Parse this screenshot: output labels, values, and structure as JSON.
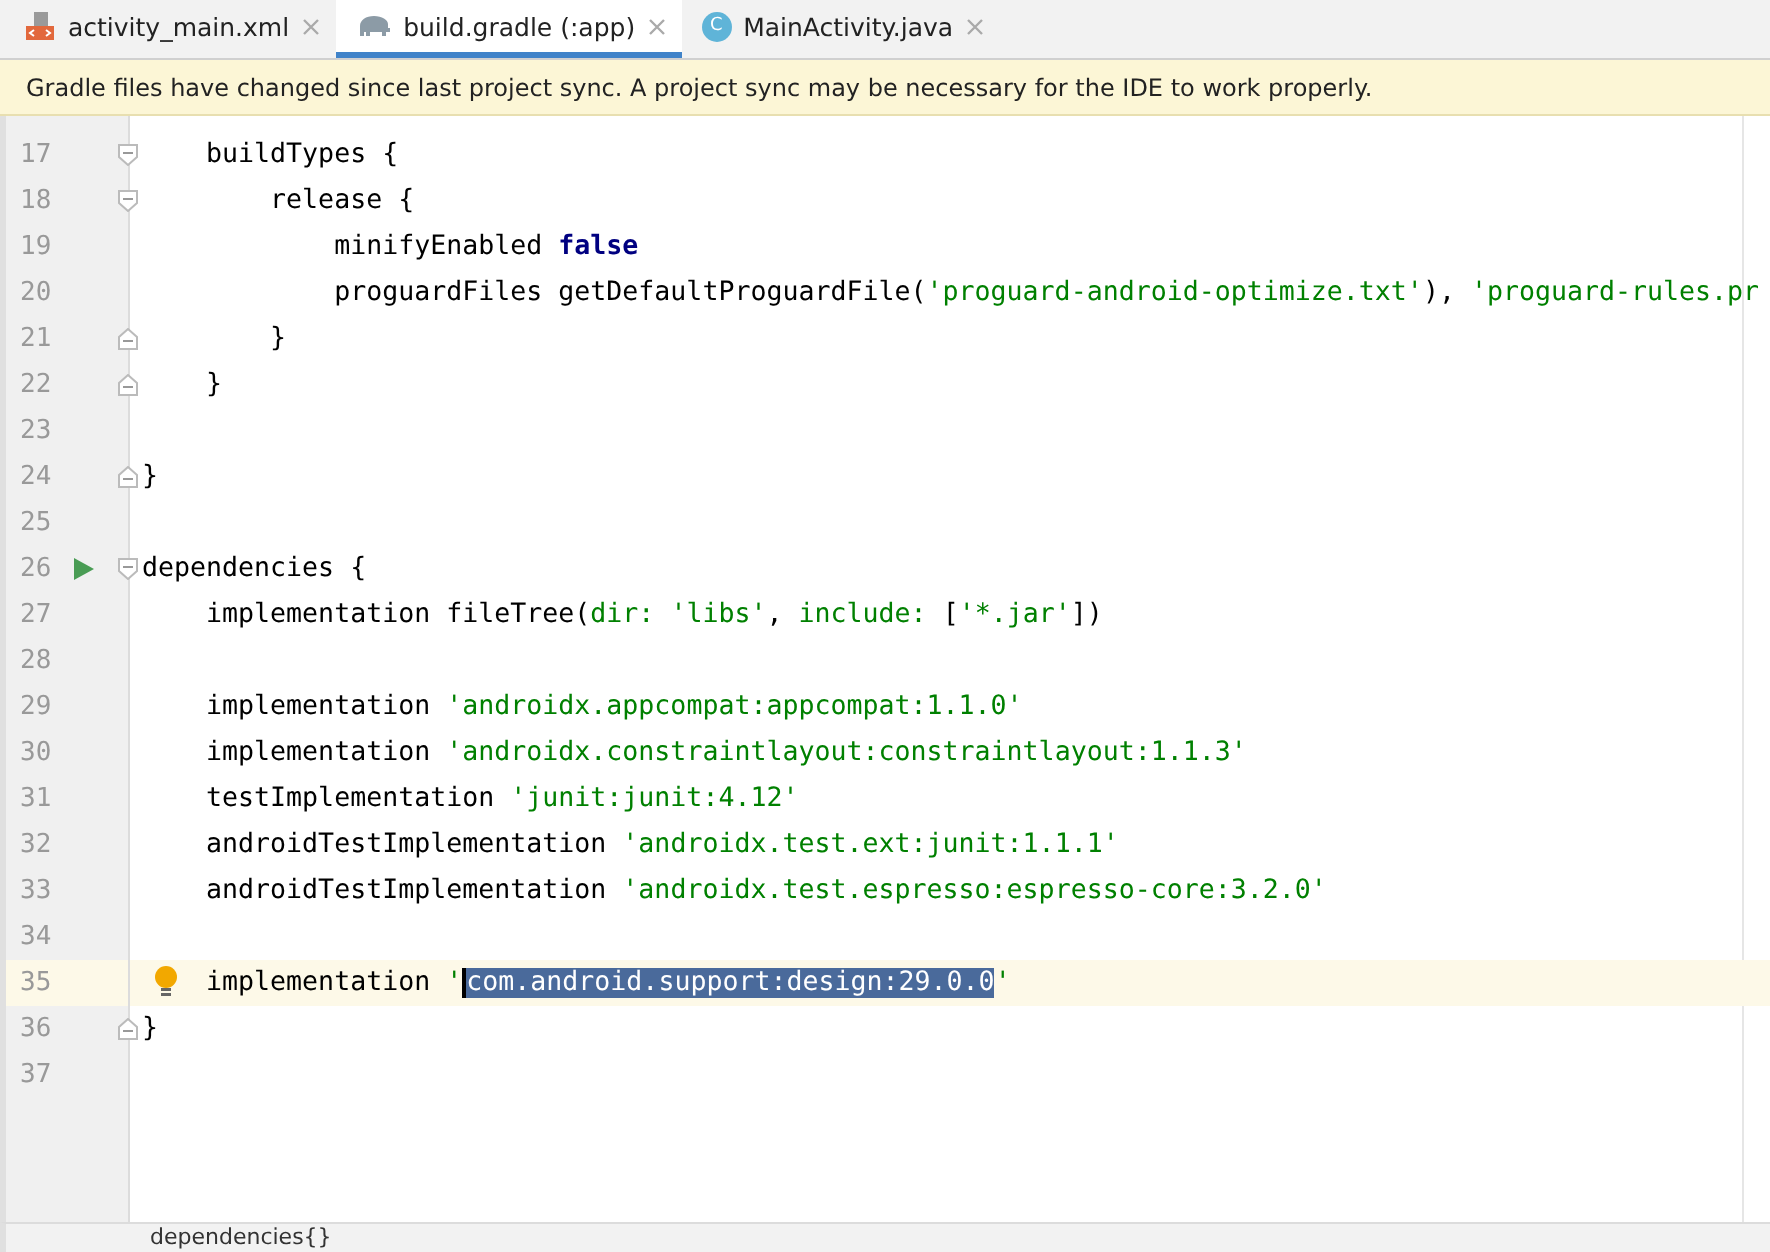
{
  "tabs": [
    {
      "label": "activity_main.xml",
      "kind": "xml",
      "selected": false
    },
    {
      "label": "build.gradle (:app)",
      "kind": "gradle",
      "selected": true
    },
    {
      "label": "MainActivity.java",
      "kind": "class",
      "icon_letter": "C",
      "selected": false
    }
  ],
  "banner": {
    "message": "Gradle files have changed since last project sync. A project sync may be necessary for the IDE to work properly."
  },
  "editor": {
    "lines": [
      {
        "number": "17",
        "kind": "block-start",
        "current": false,
        "tokens": [
          {
            "kind": "plain",
            "text": "    buildTypes {"
          }
        ]
      },
      {
        "number": "18",
        "kind": "block-start",
        "current": false,
        "tokens": [
          {
            "kind": "plain",
            "text": "        release {"
          }
        ]
      },
      {
        "number": "19",
        "kind": "plain",
        "current": false,
        "tokens": [
          {
            "kind": "plain",
            "text": "            minifyEnabled "
          },
          {
            "kind": "keyword",
            "text": "false"
          }
        ]
      },
      {
        "number": "20",
        "kind": "plain",
        "current": false,
        "tokens": [
          {
            "kind": "plain",
            "text": "            proguardFiles getDefaultProguardFile("
          },
          {
            "kind": "string",
            "text": "'proguard-android-optimize.txt'"
          },
          {
            "kind": "plain",
            "text": "), "
          },
          {
            "kind": "string",
            "text": "'proguard-rules.pr"
          }
        ]
      },
      {
        "number": "21",
        "kind": "block-end",
        "current": false,
        "tokens": [
          {
            "kind": "plain",
            "text": "        }"
          }
        ]
      },
      {
        "number": "22",
        "kind": "block-end",
        "current": false,
        "tokens": [
          {
            "kind": "plain",
            "text": "    }"
          }
        ]
      },
      {
        "number": "23",
        "kind": "plain",
        "current": false
      },
      {
        "number": "24",
        "kind": "block-end",
        "current": false,
        "tokens": [
          {
            "kind": "plain",
            "text": "}"
          }
        ]
      },
      {
        "number": "25",
        "kind": "plain",
        "current": false
      },
      {
        "number": "26",
        "kind": "run-block-start",
        "current": false,
        "tokens": [
          {
            "kind": "plain",
            "text": "dependencies {"
          }
        ]
      },
      {
        "number": "27",
        "kind": "plain",
        "current": false,
        "tokens": [
          {
            "kind": "plain",
            "text": "    implementation fileTree("
          },
          {
            "kind": "named",
            "text": "dir: "
          },
          {
            "kind": "string",
            "text": "'libs'"
          },
          {
            "kind": "plain",
            "text": ", "
          },
          {
            "kind": "named",
            "text": "include: "
          },
          {
            "kind": "plain",
            "text": "["
          },
          {
            "kind": "string",
            "text": "'*.jar'"
          },
          {
            "kind": "plain",
            "text": "])"
          }
        ]
      },
      {
        "number": "28",
        "kind": "plain",
        "current": false
      },
      {
        "number": "29",
        "kind": "plain",
        "current": false,
        "tokens": [
          {
            "kind": "plain",
            "text": "    implementation "
          },
          {
            "kind": "string",
            "text": "'androidx.appcompat:appcompat:1.1.0'"
          }
        ]
      },
      {
        "number": "30",
        "kind": "plain",
        "current": false,
        "tokens": [
          {
            "kind": "plain",
            "text": "    implementation "
          },
          {
            "kind": "string",
            "text": "'androidx.constraintlayout:constraintlayout:1.1.3'"
          }
        ]
      },
      {
        "number": "31",
        "kind": "plain",
        "current": false,
        "tokens": [
          {
            "kind": "plain",
            "text": "    testImplementation "
          },
          {
            "kind": "string",
            "text": "'junit:junit:4.12'"
          }
        ]
      },
      {
        "number": "32",
        "kind": "plain",
        "current": false,
        "tokens": [
          {
            "kind": "plain",
            "text": "    androidTestImplementation "
          },
          {
            "kind": "string",
            "text": "'androidx.test.ext:junit:1.1.1'"
          }
        ]
      },
      {
        "number": "33",
        "kind": "plain",
        "current": false,
        "tokens": [
          {
            "kind": "plain",
            "text": "    androidTestImplementation "
          },
          {
            "kind": "string",
            "text": "'androidx.test.espresso:espresso-core:3.2.0'"
          }
        ]
      },
      {
        "number": "34",
        "kind": "plain",
        "current": false
      },
      {
        "number": "35",
        "kind": "hint",
        "current": true,
        "tokens": [
          {
            "kind": "plain",
            "text": "    implementation "
          },
          {
            "kind": "string",
            "text": "'"
          },
          {
            "kind": "selected",
            "text": "com.android.support:design:29.0.0"
          },
          {
            "kind": "string",
            "text": "'"
          }
        ]
      },
      {
        "number": "36",
        "kind": "block-end",
        "current": false,
        "tokens": [
          {
            "kind": "plain",
            "text": "}"
          }
        ]
      },
      {
        "number": "37",
        "kind": "plain",
        "current": false
      }
    ]
  },
  "breadcrumb": "dependencies{}"
}
